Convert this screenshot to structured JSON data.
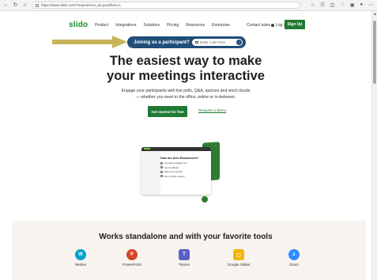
{
  "browser": {
    "url": "https://www.slido.com/?experience_id=prod/hero-1"
  },
  "header": {
    "logo": "slido",
    "nav": [
      "Product",
      "Integrations",
      "Solutions",
      "Pricing",
      "Resources",
      "Enterprise"
    ],
    "contact": "Contact sales",
    "login": "Log in",
    "signup": "Sign Up"
  },
  "join": {
    "label": "Joining as a participant?",
    "placeholder": "Enter code here"
  },
  "hero": {
    "title_line1": "The easiest way to make",
    "title_line2": "your meetings interactive",
    "sub_line1": "Engage your participants with live polls, Q&A, quizzes and word clouds",
    "sub_line2": "— whether you meet in the office, online or in-between.",
    "cta_primary": "Get started for free",
    "cta_demo": "Request a demo"
  },
  "poll": {
    "question": "How are Alex Rasmussen?",
    "options": [
      "Focused engagement",
      "Get feedback",
      "Meet new people",
      "Run a Q&A session"
    ]
  },
  "tools": {
    "title": "Works standalone and with your favorite tools",
    "items": [
      {
        "label": "Webex",
        "icon": "webex-icon",
        "color": "#00a0d1"
      },
      {
        "label": "PowerPoint",
        "icon": "powerpoint-icon",
        "color": "#d24726"
      },
      {
        "label": "Teams",
        "icon": "teams-icon",
        "color": "#5b5fc7"
      },
      {
        "label": "Google Slides",
        "icon": "google-slides-icon",
        "color": "#f4b400"
      },
      {
        "label": "Zoom",
        "icon": "zoom-icon",
        "color": "#2d8cff"
      }
    ]
  },
  "colors": {
    "brand_green": "#1f7a34",
    "join_blue": "#1f4e79",
    "annotation_arrow": "#c9b35a"
  }
}
